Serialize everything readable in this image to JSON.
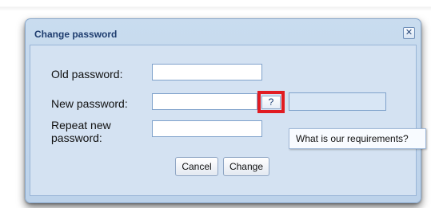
{
  "dialog": {
    "title": "Change password",
    "close_glyph": "✕"
  },
  "form": {
    "old_password_label": "Old password:",
    "old_password_value": "",
    "new_password_label": "New password:",
    "new_password_value": "",
    "repeat_label_line1": "Repeat new",
    "repeat_label_line2": "password:",
    "repeat_password_value": ""
  },
  "help": {
    "button_label": "?",
    "tooltip_text": "What is our requirements?"
  },
  "buttons": {
    "cancel_label": "Cancel",
    "change_label": "Change"
  },
  "colors": {
    "accent_highlight": "#e11b22",
    "title_text": "#1e3c6e",
    "dialog_bg": "#c9dcef"
  },
  "icons": {
    "close": "close-icon"
  }
}
